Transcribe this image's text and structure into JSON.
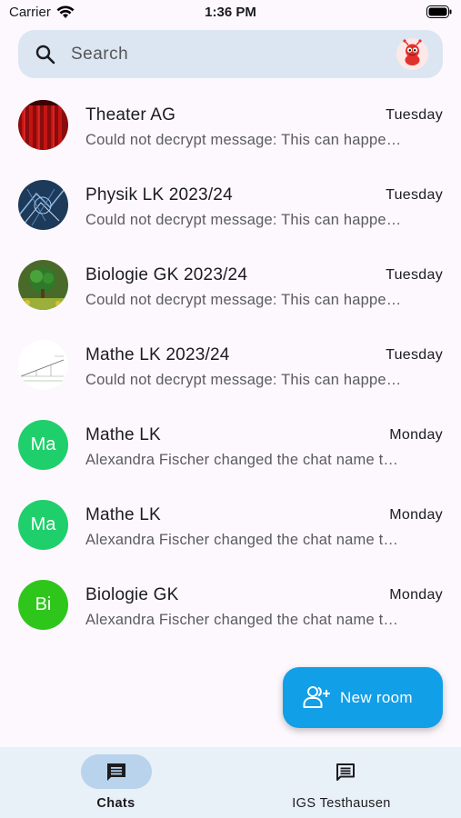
{
  "status_bar": {
    "carrier": "Carrier",
    "time": "1:36 PM"
  },
  "search": {
    "placeholder": "Search"
  },
  "chats": [
    {
      "title": "Theater AG",
      "time": "Tuesday",
      "preview": "Could not decrypt message: This can happe…",
      "avatar": "theater-image"
    },
    {
      "title": "Physik LK 2023/24",
      "time": "Tuesday",
      "preview": "Could not decrypt message: This can happe…",
      "avatar": "physics-image"
    },
    {
      "title": "Biologie GK 2023/24",
      "time": "Tuesday",
      "preview": "Could not decrypt message: This can happe…",
      "avatar": "biology-image"
    },
    {
      "title": "Mathe LK 2023/24",
      "time": "Tuesday",
      "preview": "Could not decrypt message: This can happe…",
      "avatar": "math-image"
    },
    {
      "title": "Mathe LK",
      "time": "Monday",
      "preview": "Alexandra Fischer changed the chat name t…",
      "initials": "Ma",
      "color": "#1fcf6b"
    },
    {
      "title": "Mathe LK",
      "time": "Monday",
      "preview": "Alexandra Fischer changed the chat name t…",
      "initials": "Ma",
      "color": "#1fcf6b"
    },
    {
      "title": "Biologie GK",
      "time": "Monday",
      "preview": "Alexandra Fischer changed the chat name t…",
      "initials": "Bi",
      "color": "#2fc61c"
    }
  ],
  "fab": {
    "label": "New room",
    "color": "#119fe8"
  },
  "bottom_nav": {
    "items": [
      {
        "label": "Chats",
        "icon": "chat-icon",
        "active": true
      },
      {
        "label": "IGS Testhausen",
        "icon": "chat-outline-icon",
        "active": false
      }
    ]
  },
  "colors": {
    "background": "#fcf8fd",
    "search_bg": "#dce6f2",
    "nav_bg": "#e8f0f8",
    "nav_indicator": "#b9d3ec"
  }
}
